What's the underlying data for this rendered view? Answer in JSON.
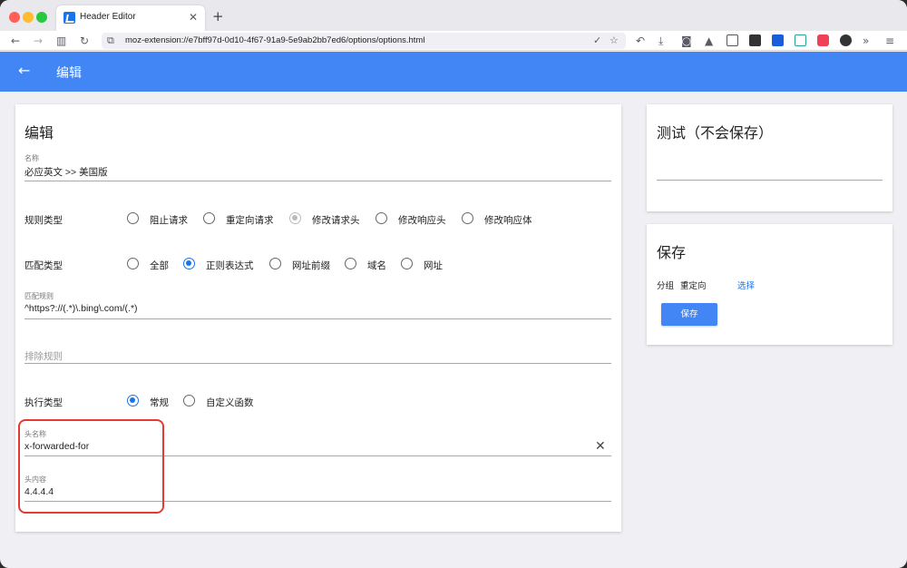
{
  "browser": {
    "tab_title": "Header Editor",
    "url": "moz-extension://e7bff97d-0d10-4f67-91a9-5e9ab2bb7ed6/options/options.html"
  },
  "appbar": {
    "title": "编辑"
  },
  "edit": {
    "heading": "编辑",
    "name": {
      "label": "名称",
      "value": "必应英文  >> 美国版"
    },
    "rule_type": {
      "label": "规则类型",
      "options": [
        "阻止请求",
        "重定向请求",
        "修改请求头",
        "修改响应头",
        "修改响应体"
      ],
      "selected": "修改请求头"
    },
    "match_type": {
      "label": "匹配类型",
      "options": [
        "全部",
        "正则表达式",
        "网址前缀",
        "域名",
        "网址"
      ],
      "selected": "正则表达式"
    },
    "match_rule": {
      "label": "匹配规则",
      "value": "^https?://(.*)\\.bing\\.com/(.*)"
    },
    "exclude_rule": {
      "placeholder": "排除规则"
    },
    "exec_type": {
      "label": "执行类型",
      "options": [
        "常规",
        "自定义函数"
      ],
      "selected": "常规"
    },
    "header_name": {
      "label": "头名称",
      "value": "x-forwarded-for"
    },
    "header_value": {
      "label": "头内容",
      "value": "4.4.4.4"
    }
  },
  "test": {
    "heading": "测试（不会保存）"
  },
  "save": {
    "heading": "保存",
    "group_label": "分组",
    "group_value": "重定向",
    "choose_link": "选择",
    "button": "保存"
  },
  "colors": {
    "accent": "#4285f4",
    "highlight": "#e53935"
  }
}
